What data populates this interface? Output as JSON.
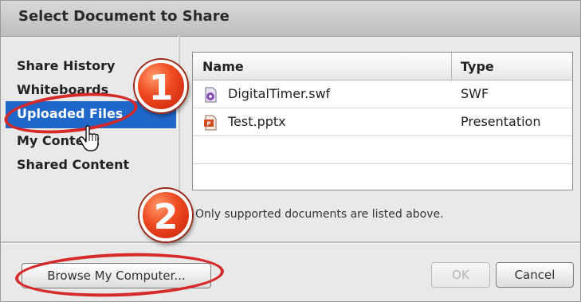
{
  "dialog": {
    "title": "Select Document to Share"
  },
  "sidebar": {
    "items": [
      {
        "label": "Share History"
      },
      {
        "label": "Whiteboards"
      },
      {
        "label": "Uploaded Files",
        "selected": true
      },
      {
        "label": "My Content"
      },
      {
        "label": "Shared Content"
      }
    ]
  },
  "table": {
    "headers": {
      "name": "Name",
      "type": "Type"
    },
    "rows": [
      {
        "name": "DigitalTimer.swf",
        "type": "SWF",
        "icon": "swf-file-icon"
      },
      {
        "name": "Test.pptx",
        "type": "Presentation",
        "icon": "pptx-file-icon"
      }
    ]
  },
  "info_text": "Only supported documents are listed above.",
  "buttons": {
    "browse": "Browse My Computer...",
    "ok": "OK",
    "cancel": "Cancel"
  },
  "annotations": {
    "step1": "1",
    "step2": "2"
  },
  "colors": {
    "selection": "#1f67c8",
    "callout": "#e04020",
    "ring": "#d62a2a"
  }
}
